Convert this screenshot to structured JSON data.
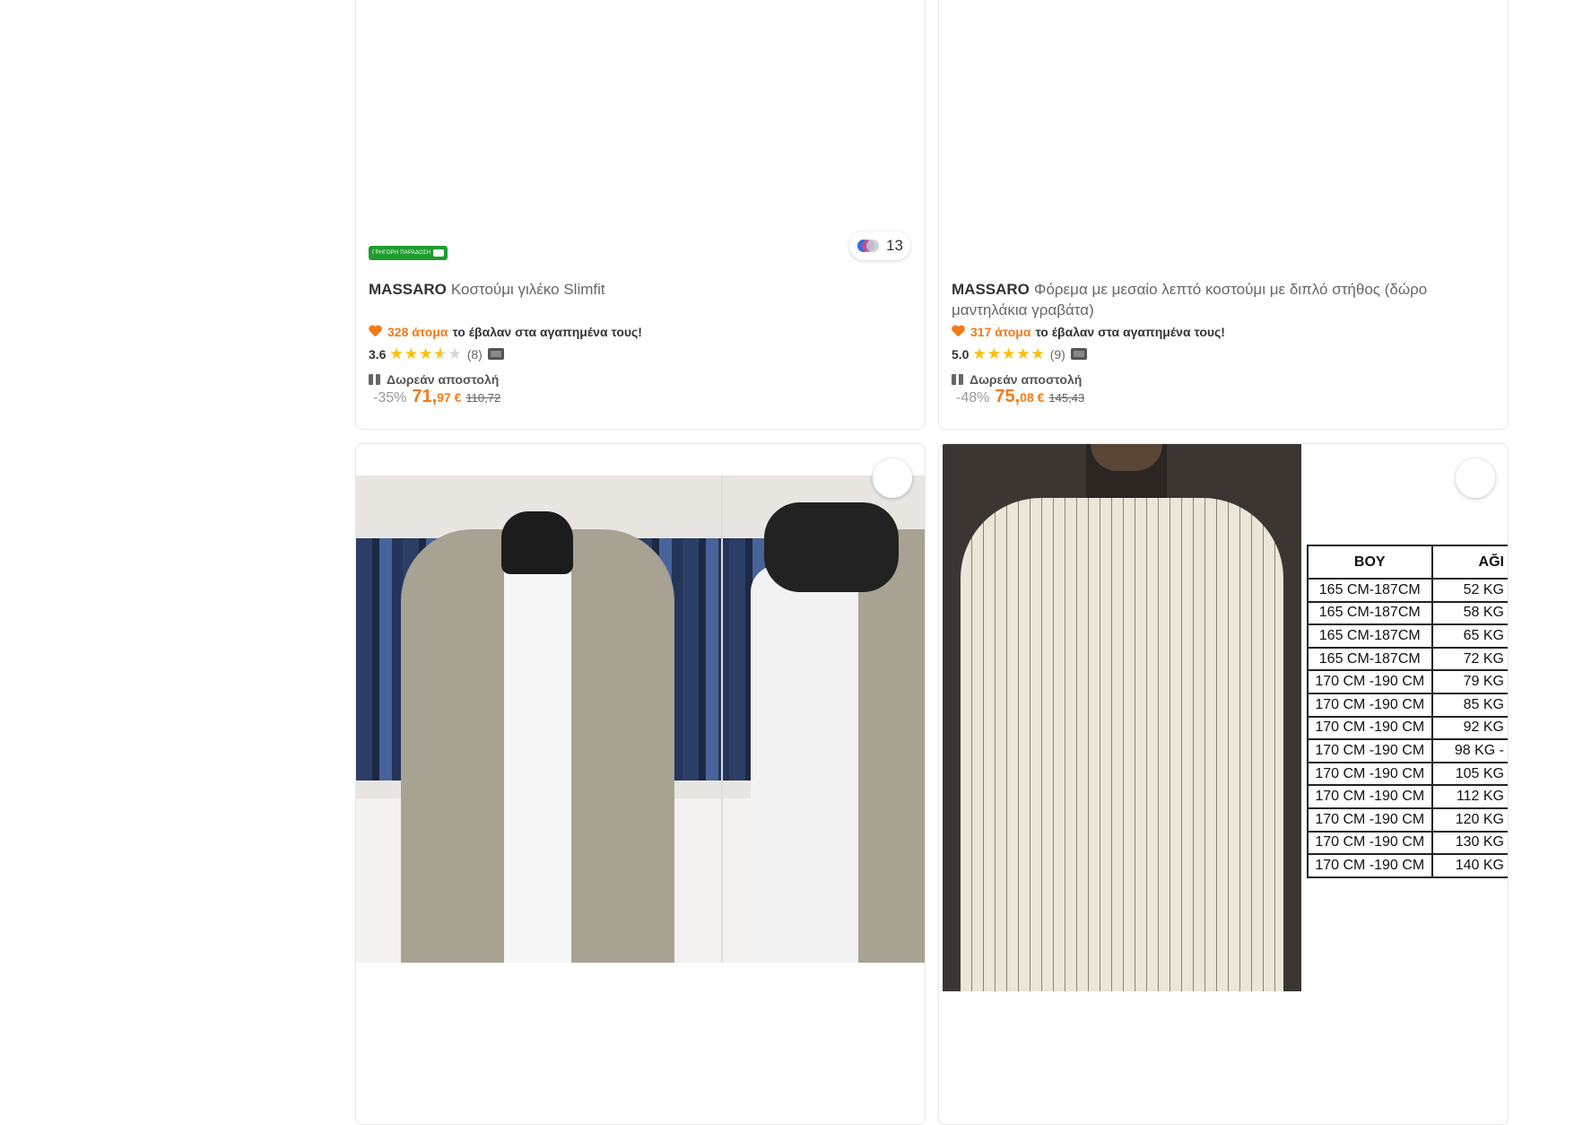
{
  "products": [
    {
      "fast_delivery": "ΓΡΗΓΟΡΗ ΠΑΡΑΔΟΣΗ",
      "colors_count": "13",
      "brand": "MASSARO",
      "name": "Κοστούμι γιλέκο Slimfit",
      "fav_count": "328 άτομα",
      "fav_text": "το έβαλαν στα αγαπημένα τους!",
      "rating": "3.6",
      "rating_value": 3.6,
      "review_count": "(8)",
      "shipping": "Δωρεάν αποστολή",
      "discount": "-35%",
      "price_main": "71,",
      "price_dec": "97 €",
      "price_old": "110,72"
    },
    {
      "brand": "MASSARO",
      "name": "Φόρεμα με μεσαίο λεπτό κοστούμι με διπλό στήθος (δώρο μαντηλάκια γραβάτα)",
      "fav_count": "317 άτομα",
      "fav_text": "το έβαλαν στα αγαπημένα τους!",
      "rating": "5.0",
      "rating_value": 5.0,
      "review_count": "(9)",
      "shipping": "Δωρεάν αποστολή",
      "discount": "-48%",
      "price_main": "75,",
      "price_dec": "08 €",
      "price_old": "145,43"
    }
  ],
  "size_chart": {
    "headers": [
      "BOY",
      "AĞI"
    ],
    "rows": [
      [
        "165 CM-187CM",
        "52 KG"
      ],
      [
        "165 CM-187CM",
        "58 KG"
      ],
      [
        "165 CM-187CM",
        "65 KG"
      ],
      [
        "165 CM-187CM",
        "72 KG"
      ],
      [
        "170 CM -190 CM",
        "79 KG"
      ],
      [
        "170 CM -190 CM",
        "85 KG"
      ],
      [
        "170 CM -190 CM",
        "92 KG"
      ],
      [
        "170 CM -190 CM",
        "98 KG -"
      ],
      [
        "170 CM -190 CM",
        "105 KG"
      ],
      [
        "170 CM -190 CM",
        "112 KG"
      ],
      [
        "170 CM -190 CM",
        "120 KG"
      ],
      [
        "170 CM -190 CM",
        "130 KG"
      ],
      [
        "170 CM -190 CM",
        "140 KG"
      ]
    ]
  },
  "colors": {
    "accent": "#f27a1a",
    "star": "#ffc000",
    "fast_badge": "#1f9d2e"
  }
}
